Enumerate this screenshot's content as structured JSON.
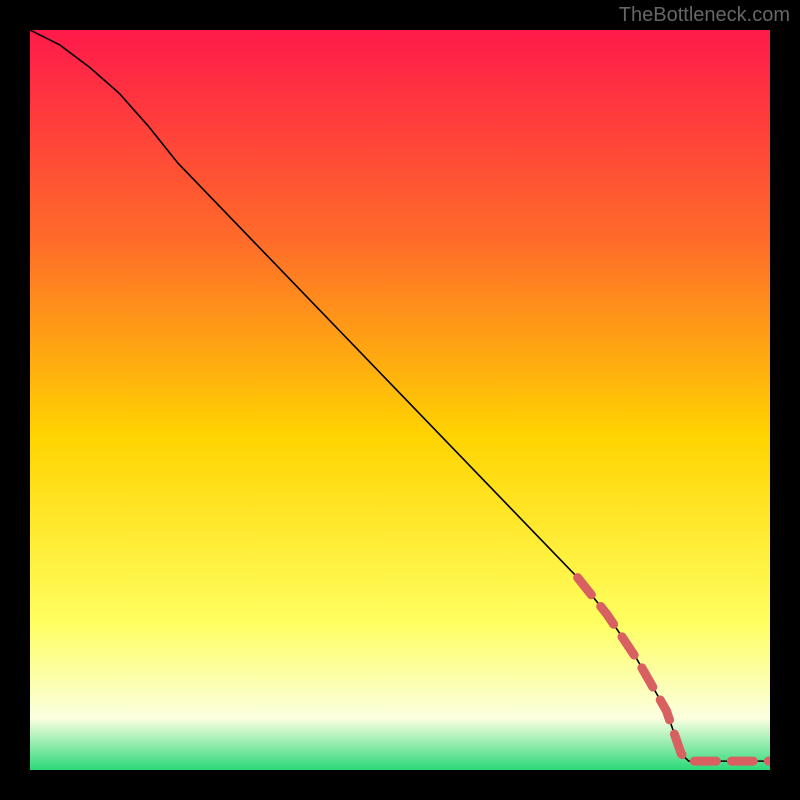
{
  "watermark": "TheBottleneck.com",
  "colors": {
    "page_bg": "#000000",
    "gradient_top": "#ff1a4a",
    "gradient_mid_upper": "#ff6a2a",
    "gradient_mid": "#ffd400",
    "gradient_mid_lower": "#ffff60",
    "gradient_near_bottom": "#fbffe0",
    "gradient_bottom": "#2bd97a",
    "curve": "#000000",
    "dash": "#d86060"
  },
  "chart_data": {
    "type": "line",
    "title": "",
    "xlabel": "",
    "ylabel": "",
    "xlim": [
      0,
      100
    ],
    "ylim": [
      0,
      100
    ],
    "grid": false,
    "legend": false,
    "note": "Axes are unlabeled; values in 0–100 plot-area percent. Curve is a single black solid line plus a salmon dashed overlay segment near the end.",
    "series": [
      {
        "name": "solid_curve",
        "style": "solid",
        "color_key": "curve",
        "points": [
          {
            "x": 0,
            "y": 100
          },
          {
            "x": 4,
            "y": 98
          },
          {
            "x": 8,
            "y": 95
          },
          {
            "x": 12,
            "y": 91.5
          },
          {
            "x": 16,
            "y": 87
          },
          {
            "x": 20,
            "y": 82
          },
          {
            "x": 74,
            "y": 26
          },
          {
            "x": 78,
            "y": 21
          },
          {
            "x": 82,
            "y": 15
          },
          {
            "x": 86,
            "y": 8
          },
          {
            "x": 88,
            "y": 2.2
          },
          {
            "x": 89,
            "y": 1.2
          },
          {
            "x": 100,
            "y": 1.2
          }
        ]
      },
      {
        "name": "dashed_overlay",
        "style": "dashed",
        "color_key": "dash",
        "points": [
          {
            "x": 74,
            "y": 26
          },
          {
            "x": 78,
            "y": 21
          },
          {
            "x": 82,
            "y": 15
          },
          {
            "x": 86,
            "y": 8
          },
          {
            "x": 88,
            "y": 2.2
          },
          {
            "x": 89,
            "y": 1.2
          },
          {
            "x": 100,
            "y": 1.2
          }
        ]
      }
    ]
  }
}
